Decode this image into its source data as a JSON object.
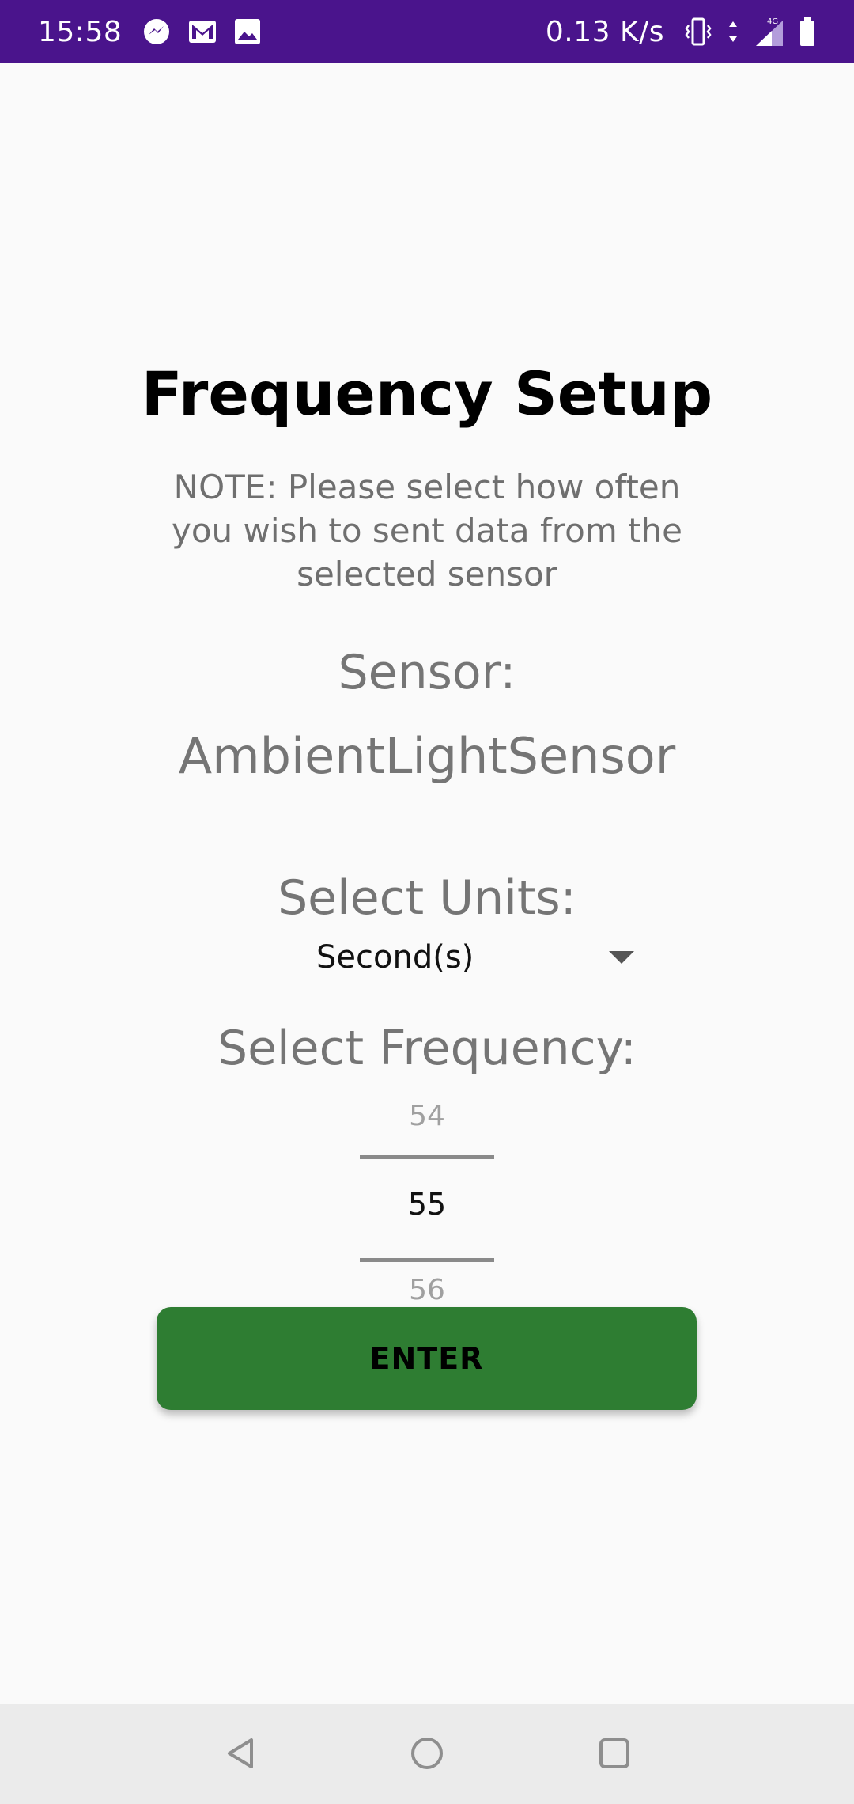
{
  "status_bar": {
    "time": "15:58",
    "left_icons": [
      "messenger-icon",
      "gmail-icon",
      "gallery-icon"
    ],
    "net_speed": "0.13 K/s",
    "right_icons": [
      "vibrate-icon",
      "data-arrows-icon",
      "signal-4g-icon",
      "battery-icon"
    ],
    "network_type": "4G"
  },
  "page": {
    "title": "Frequency Setup",
    "note": "NOTE: Please select how often you wish to sent data from the selected sensor",
    "sensor_label": "Sensor:",
    "sensor_name": "AmbientLightSensor",
    "units_label": "Select Units:",
    "units_selected": "Second(s)",
    "frequency_label": "Select Frequency:",
    "frequency_picker": {
      "previous": "54",
      "current": "55",
      "next": "56"
    },
    "enter_button": "ENTER"
  },
  "nav_bar": {
    "icons": [
      "back-icon",
      "home-icon",
      "recents-icon"
    ]
  },
  "colors": {
    "status_bar": "#4a148c",
    "background": "#fafafa",
    "button": "#2e7d32",
    "nav_bar": "#ebebeb"
  }
}
